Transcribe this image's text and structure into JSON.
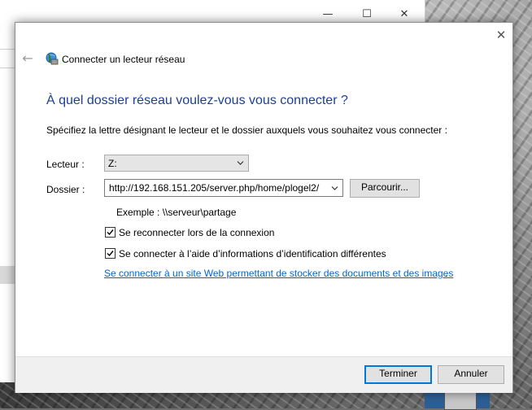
{
  "wizard": {
    "title": "Connecter un lecteur réseau",
    "heading": "À quel dossier réseau voulez-vous vous connecter ?",
    "description": "Spécifiez la lettre désignant le lecteur et le dossier auxquels vous souhaitez vous connecter :",
    "drive_label": "Lecteur :",
    "drive_value": "Z:",
    "folder_label": "Dossier :",
    "folder_value": "http://192.168.151.205/server.php/home/plogel2/",
    "browse_label": "Parcourir...",
    "example_text": "Exemple : \\\\serveur\\partage",
    "reconnect_label": "Se reconnecter lors de la connexion",
    "reconnect_checked": true,
    "credentials_label": "Se connecter à l’aide d’informations d’identification différentes",
    "credentials_checked": true,
    "link_text": "Se connecter à un site Web permettant de stocker des documents et des images",
    "link_suffix": ".",
    "finish_label": "Terminer",
    "cancel_label": "Annuler"
  },
  "background_window": {
    "minimize_glyph": "—",
    "maximize_glyph": "☐",
    "close_glyph": "✕"
  },
  "icons": {
    "close": "close-icon",
    "back": "back-arrow-icon",
    "network_drive": "network-drive-icon",
    "dropdown": "chevron-down-icon",
    "checkmark": "checkmark-icon"
  },
  "colors": {
    "heading": "#1c3f94",
    "link": "#0066cc",
    "primary_border": "#0078d7"
  }
}
